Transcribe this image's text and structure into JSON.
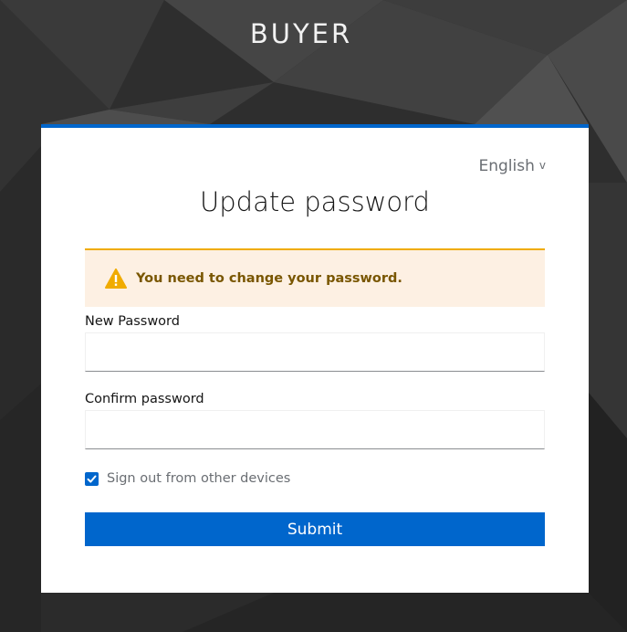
{
  "brand": {
    "title": "BUYER"
  },
  "card": {
    "language": {
      "selected": "English",
      "chevron": "v"
    },
    "title": "Update password",
    "alert": {
      "icon": "warning-icon",
      "message": "You need to change your password."
    },
    "form": {
      "new_password": {
        "label": "New Password",
        "value": ""
      },
      "confirm_password": {
        "label": "Confirm password",
        "value": ""
      },
      "logout_sessions": {
        "label": "Sign out from other devices",
        "checked": true
      },
      "submit_label": "Submit"
    }
  },
  "colors": {
    "accent": "#0066cc",
    "warning": "#f0ab00",
    "warning_bg": "#fdf0e3",
    "warning_text": "#795600"
  }
}
